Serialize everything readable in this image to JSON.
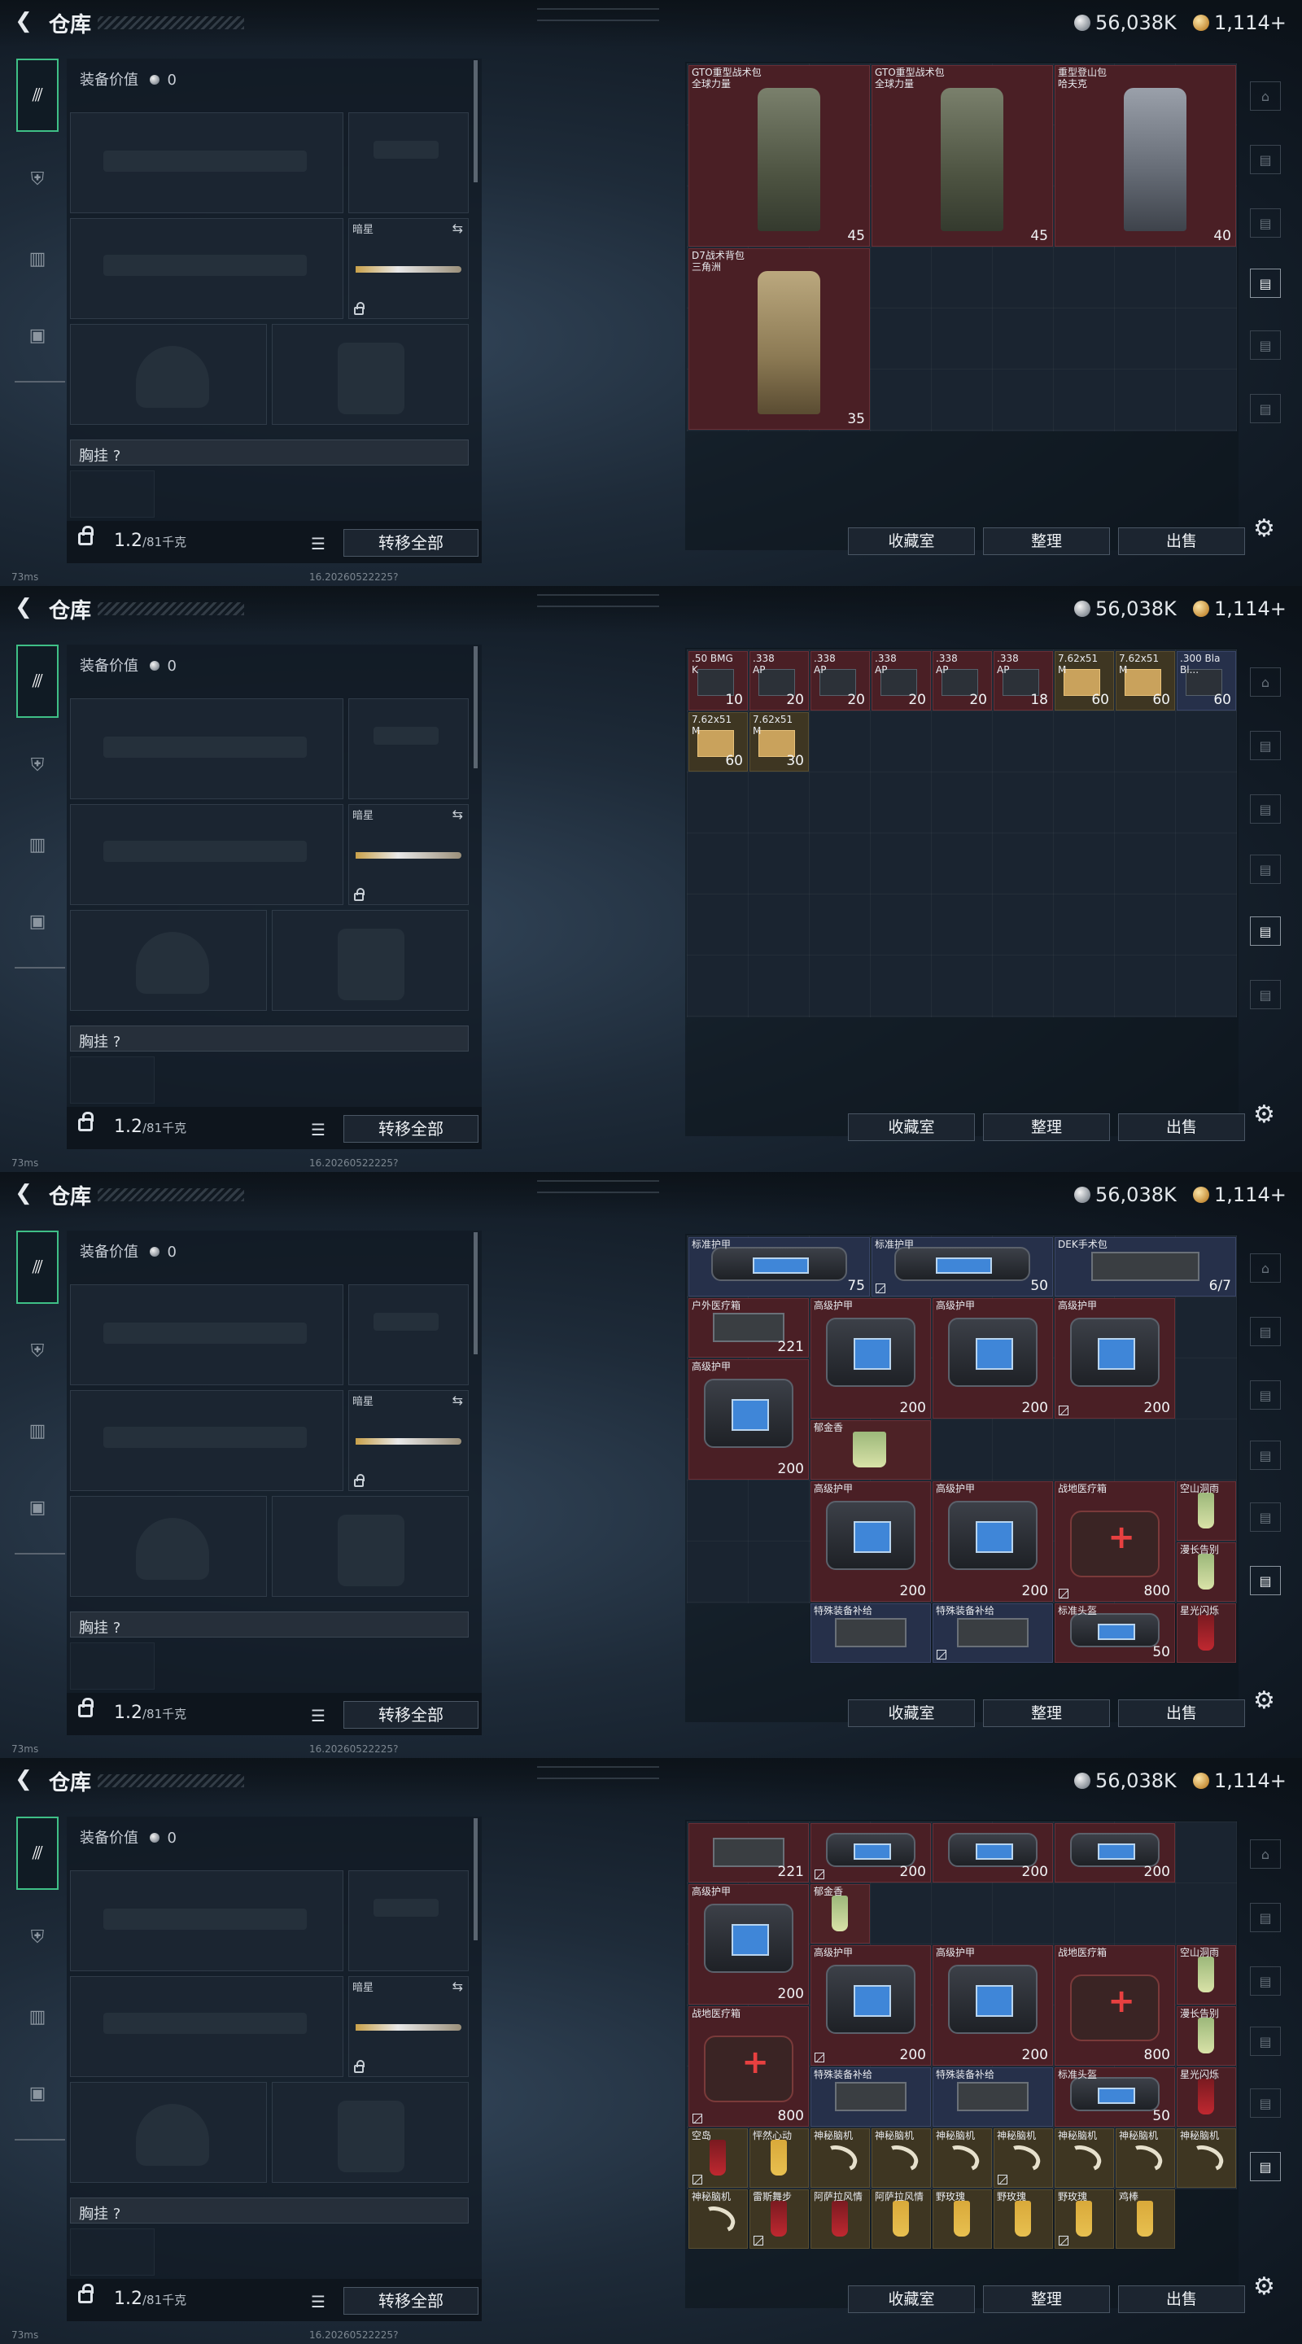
{
  "header": {
    "title": "仓库",
    "silver": "56,038K",
    "gold": "1,114+"
  },
  "equipment": {
    "value_label": "装备价值",
    "value": "0",
    "knife_label": "暗星",
    "chest_label": "胸挂",
    "chest_q": "?"
  },
  "footer": {
    "weight": "1.2",
    "weight_max": "/81千克",
    "transfer_all": "转移全部"
  },
  "buttons": {
    "collection": "收藏室",
    "sort": "整理",
    "sell": "出售"
  },
  "status": {
    "ping": "73ms",
    "build": "16.20260522225?"
  },
  "icons": [
    "back-arrow-icon",
    "silver-coin-icon",
    "gold-coin-icon",
    "gun-icon",
    "armor-icon",
    "backpack-icon",
    "case-icon",
    "lock-icon",
    "list-icon",
    "gear-icon",
    "swap-icon"
  ],
  "panels": [
    {
      "tab": "backpacks",
      "items": [
        {
          "name": "GTO重型战术包\n全球力量",
          "value": "45"
        },
        {
          "name": "GTO重型战术包\n全球力量",
          "value": "45"
        },
        {
          "name": "重型登山包\n哈夫克",
          "value": "40"
        },
        {
          "name": "D7战术背包\n三角洲",
          "value": "35"
        }
      ]
    },
    {
      "tab": "ammo",
      "items": [
        {
          "name": ".50 BMG\nK",
          "value": "10"
        },
        {
          "name": ".338\nAP",
          "value": "20"
        },
        {
          "name": ".338\nAP",
          "value": "20"
        },
        {
          "name": ".338\nAP",
          "value": "20"
        },
        {
          "name": ".338\nAP",
          "value": "20"
        },
        {
          "name": ".338\nAP",
          "value": "18"
        },
        {
          "name": "7.62x51\nM",
          "value": "60"
        },
        {
          "name": "7.62x51\nM",
          "value": "60"
        },
        {
          "name": ".300 Bla\nBl...",
          "value": "60"
        },
        {
          "name": "7.62x51\nM",
          "value": "60"
        },
        {
          "name": "7.62x51\nM",
          "value": "30"
        }
      ]
    },
    {
      "tab": "consumables-top",
      "items": [
        {
          "name": "标准护甲",
          "value": "75"
        },
        {
          "name": "标准护甲",
          "value": "50"
        },
        {
          "name": "DEK手术包",
          "value": "6/7"
        },
        {
          "name": "户外医疗箱",
          "value": "221"
        },
        {
          "name": "高级护甲",
          "value": "200"
        },
        {
          "name": "高级护甲",
          "value": "200"
        },
        {
          "name": "高级护甲",
          "value": "200"
        },
        {
          "name": "高级护甲",
          "value": "200"
        },
        {
          "name": "郁金香",
          "value": ""
        },
        {
          "name": "高级护甲",
          "value": "200"
        },
        {
          "name": "高级护甲",
          "value": "200"
        },
        {
          "name": "战地医疗箱",
          "value": "800"
        },
        {
          "name": "空山洞雨",
          "value": ""
        },
        {
          "name": "漫长告别",
          "value": ""
        },
        {
          "name": "战地医疗箱",
          "value": "800"
        },
        {
          "name": "特殊装备补给",
          "value": ""
        },
        {
          "name": "特殊装备补给",
          "value": ""
        },
        {
          "name": "标准头盔",
          "value": "50"
        },
        {
          "name": "星光闪烁",
          "value": ""
        },
        {
          "name": "空岛",
          "value": ""
        },
        {
          "name": "怦然心动",
          "value": ""
        },
        {
          "name": "神秘脑机",
          "value": ""
        },
        {
          "name": "神秘脑机",
          "value": ""
        },
        {
          "name": "神秘脑机",
          "value": ""
        },
        {
          "name": "神秘脑机",
          "value": ""
        },
        {
          "name": "神秘脑机",
          "value": ""
        },
        {
          "name": "神秘脑机",
          "value": ""
        },
        {
          "name": "神秘脑机",
          "value": ""
        },
        {
          "name": "雷斯舞步",
          "value": ""
        },
        {
          "name": "阿萨拉风情",
          "value": ""
        },
        {
          "name": "阿萨拉风情",
          "value": ""
        },
        {
          "name": "野玫瑰",
          "value": ""
        },
        {
          "name": "野玫瑰",
          "value": ""
        },
        {
          "name": "野玫瑰",
          "value": ""
        },
        {
          "name": "鸡棒",
          "value": ""
        }
      ]
    },
    {
      "tab": "consumables-scrolled",
      "items": [
        {
          "name": "",
          "value": "221"
        },
        {
          "name": "",
          "value": "200"
        },
        {
          "name": "",
          "value": "200"
        },
        {
          "name": "",
          "value": "200"
        },
        {
          "name": "高级护甲",
          "value": "200"
        },
        {
          "name": "郁金香",
          "value": ""
        },
        {
          "name": "高级护甲",
          "value": "200"
        },
        {
          "name": "高级护甲",
          "value": "200"
        },
        {
          "name": "战地医疗箱",
          "value": "800"
        },
        {
          "name": "空山洞雨",
          "value": ""
        },
        {
          "name": "漫长告别",
          "value": ""
        },
        {
          "name": "战地医疗箱",
          "value": "800"
        },
        {
          "name": "特殊装备补给",
          "value": ""
        },
        {
          "name": "特殊装备补给",
          "value": ""
        },
        {
          "name": "标准头盔",
          "value": "50"
        },
        {
          "name": "星光闪烁",
          "value": ""
        },
        {
          "name": "空岛",
          "value": ""
        },
        {
          "name": "怦然心动",
          "value": ""
        },
        {
          "name": "神秘脑机",
          "value": ""
        },
        {
          "name": "神秘脑机",
          "value": ""
        },
        {
          "name": "神秘脑机",
          "value": ""
        },
        {
          "name": "神秘脑机",
          "value": ""
        },
        {
          "name": "神秘脑机",
          "value": ""
        },
        {
          "name": "神秘脑机",
          "value": ""
        },
        {
          "name": "神秘脑机",
          "value": ""
        },
        {
          "name": "神秘脑机",
          "value": ""
        },
        {
          "name": "雷斯舞步",
          "value": ""
        },
        {
          "name": "阿萨拉风情",
          "value": ""
        },
        {
          "name": "阿萨拉风情",
          "value": ""
        },
        {
          "name": "野玫瑰",
          "value": ""
        },
        {
          "name": "野玫瑰",
          "value": ""
        },
        {
          "name": "野玫瑰",
          "value": ""
        },
        {
          "name": "鸡棒",
          "value": ""
        }
      ]
    }
  ]
}
